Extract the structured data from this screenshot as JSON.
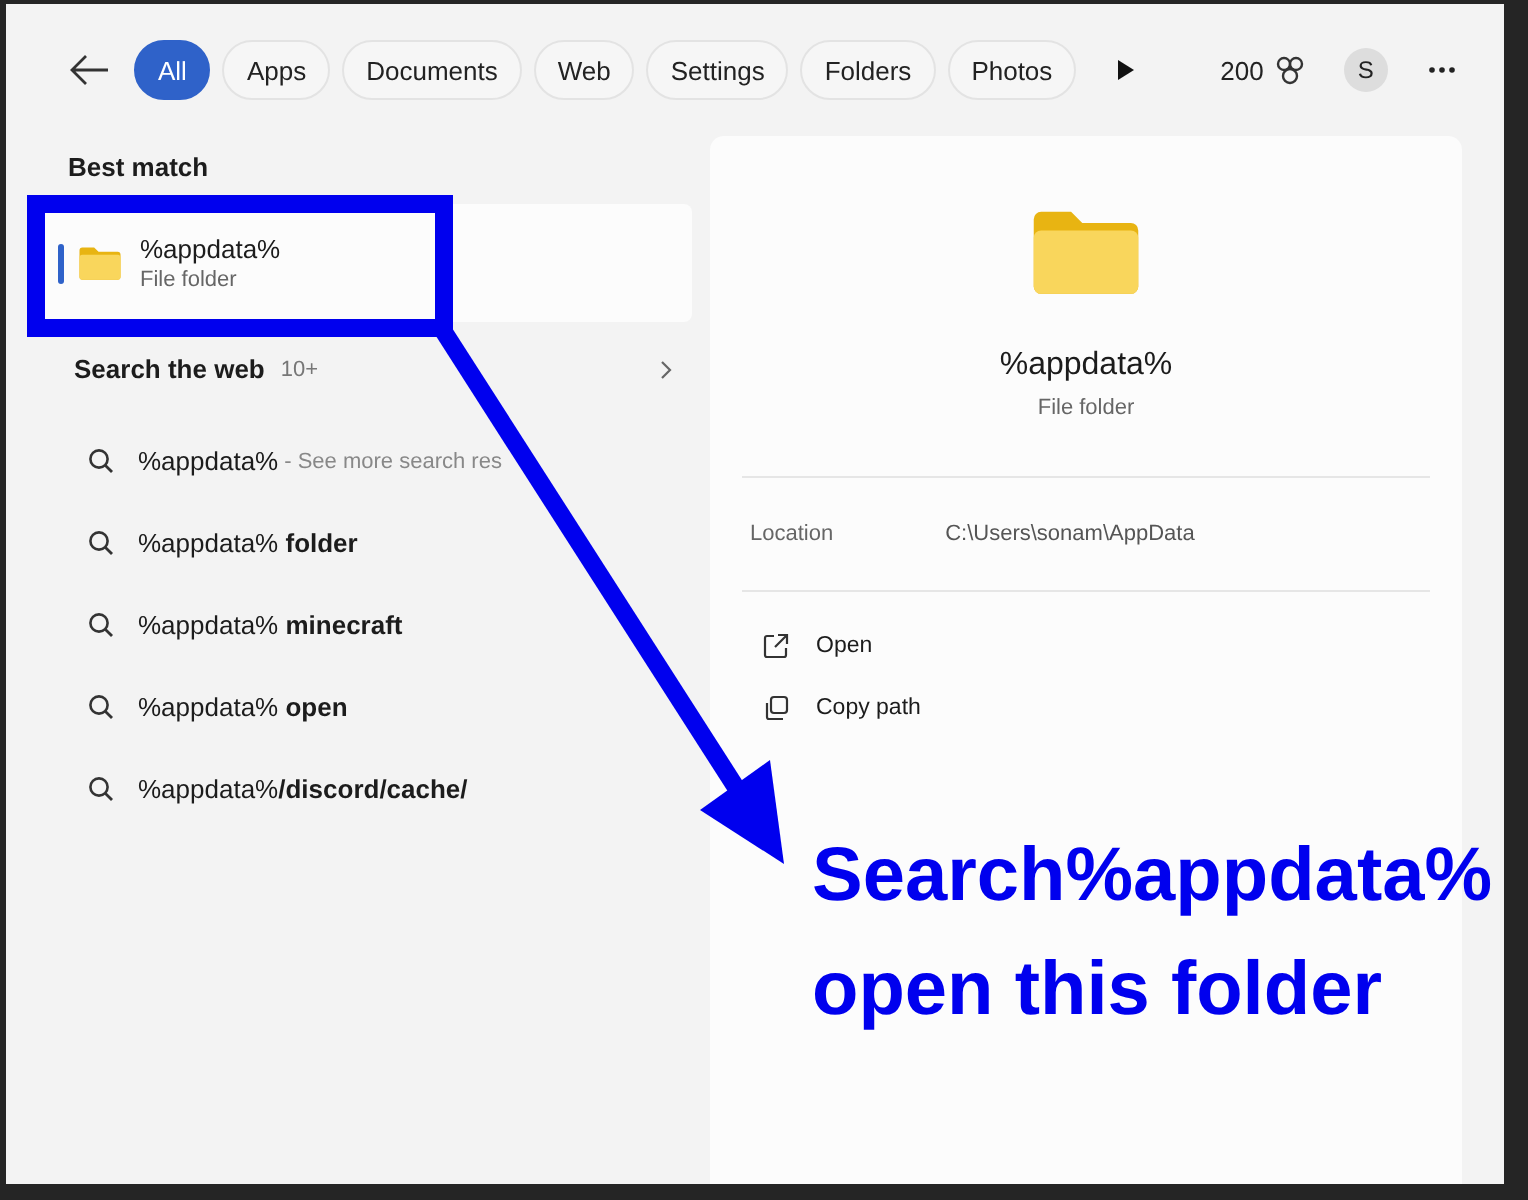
{
  "filters": [
    {
      "label": "All",
      "selected": true
    },
    {
      "label": "Apps",
      "selected": false
    },
    {
      "label": "Documents",
      "selected": false
    },
    {
      "label": "Web",
      "selected": false
    },
    {
      "label": "Settings",
      "selected": false
    },
    {
      "label": "Folders",
      "selected": false
    },
    {
      "label": "Photos",
      "selected": false
    }
  ],
  "points": "200",
  "avatar": "S",
  "best_match": {
    "heading": "Best match",
    "title": "%appdata%",
    "subtitle": "File folder",
    "selected": true
  },
  "web": {
    "heading": "Search the web",
    "count": "10+",
    "results": [
      {
        "text": "%appdata%",
        "hint": "- See more search res"
      },
      {
        "text": "%appdata% **folder**"
      },
      {
        "text": "%appdata% **minecraft**"
      },
      {
        "text": "%appdata% **open**"
      },
      {
        "text": "%appdata%**/discord/cache/**"
      }
    ]
  },
  "details": {
    "title": "%appdata%",
    "subtitle": "File folder",
    "location_label": "Location",
    "location": "C:\\Users\\sonam\\AppData",
    "actions": [
      {
        "kind": "open",
        "label": "Open"
      },
      {
        "kind": "copy",
        "label": "Copy path"
      }
    ]
  },
  "annotation": {
    "lines": [
      "Search%appdata%",
      "open this folder"
    ]
  }
}
